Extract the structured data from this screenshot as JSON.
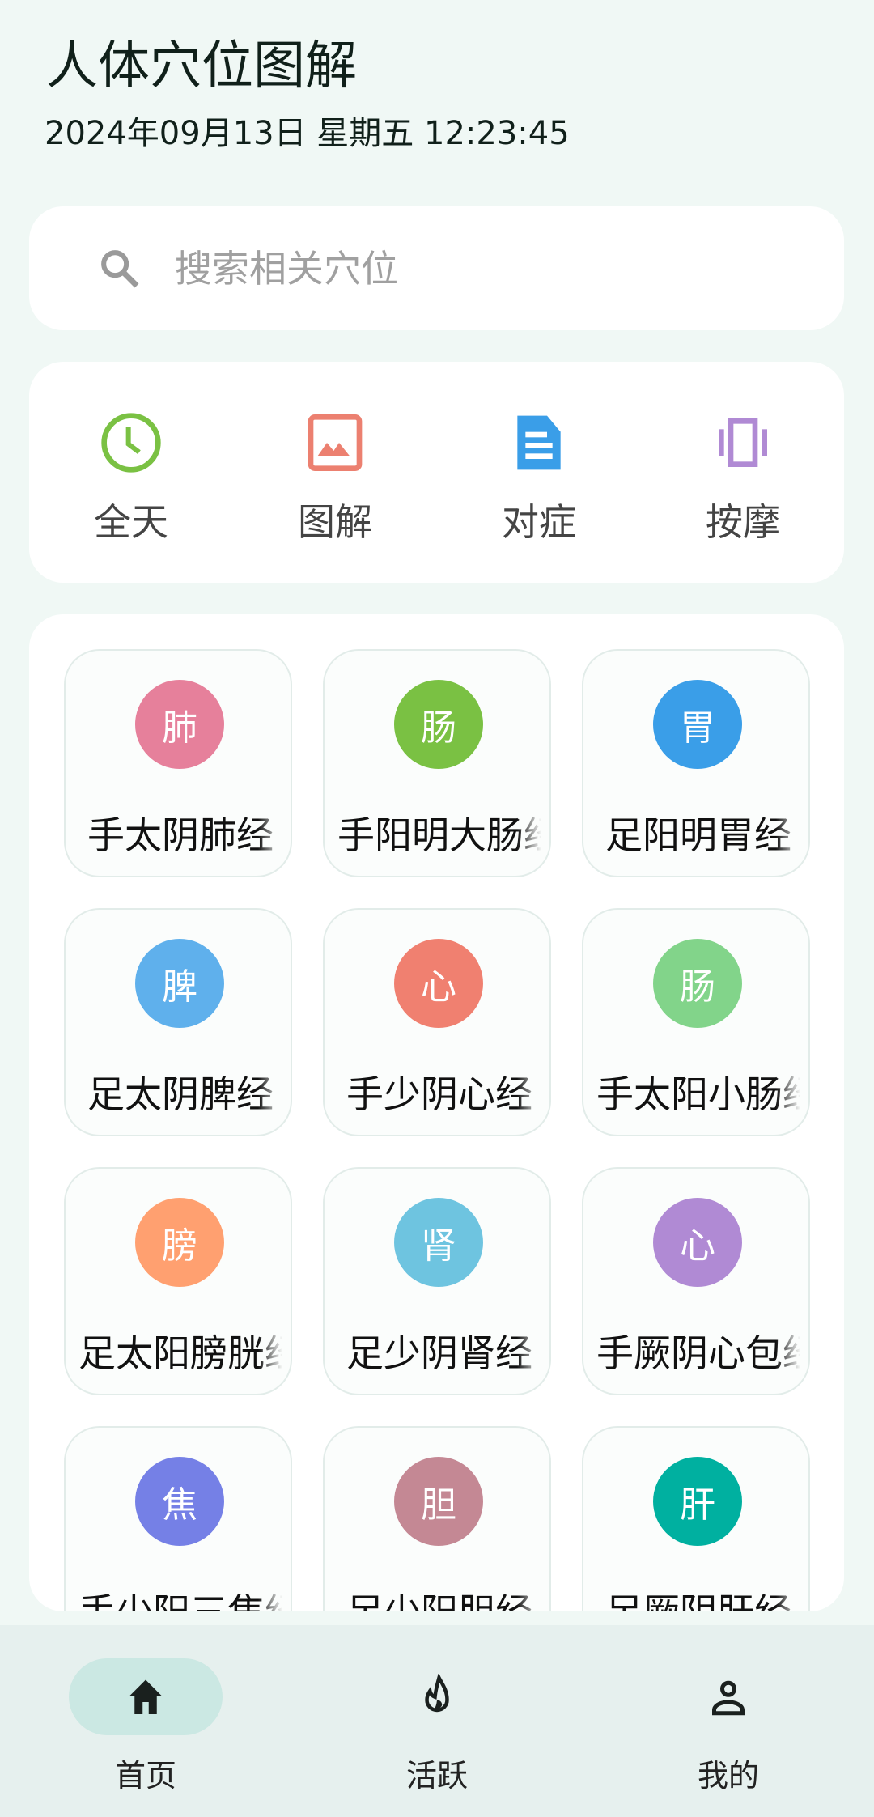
{
  "header": {
    "title": "人体穴位图解",
    "datetime": "2024年09月13日 星期五  12:23:45"
  },
  "search": {
    "placeholder": "搜索相关穴位",
    "icon": "search-icon"
  },
  "quick": [
    {
      "label": "全天",
      "icon": "clock-icon",
      "color": "#7ac143"
    },
    {
      "label": "图解",
      "icon": "image-icon",
      "color": "#ec8070"
    },
    {
      "label": "对症",
      "icon": "document-icon",
      "color": "#3a9ee8"
    },
    {
      "label": "按摩",
      "icon": "vibration-icon",
      "color": "#b08ad4"
    }
  ],
  "meridians": [
    {
      "char": "肺",
      "label": "手太阴肺经",
      "color": "#e6809b"
    },
    {
      "char": "肠",
      "label": "手阳明大肠经",
      "color": "#7ac143"
    },
    {
      "char": "胃",
      "label": "足阳明胃经",
      "color": "#3a9ee8"
    },
    {
      "char": "脾",
      "label": "足太阴脾经",
      "color": "#5fb0ec"
    },
    {
      "char": "心",
      "label": "手少阴心经",
      "color": "#f08070"
    },
    {
      "char": "肠",
      "label": "手太阳小肠经",
      "color": "#82d48a"
    },
    {
      "char": "膀",
      "label": "足太阳膀胱经",
      "color": "#ffa070"
    },
    {
      "char": "肾",
      "label": "足少阴肾经",
      "color": "#6ec4e0"
    },
    {
      "char": "心",
      "label": "手厥阴心包经",
      "color": "#b08ad4"
    },
    {
      "char": "焦",
      "label": "手少阳三焦经",
      "color": "#7580e6"
    },
    {
      "char": "胆",
      "label": "足少阳胆经",
      "color": "#c48894"
    },
    {
      "char": "肝",
      "label": "足厥阴肝经",
      "color": "#00b0a0"
    }
  ],
  "nav": [
    {
      "label": "首页",
      "icon": "home-icon",
      "active": true
    },
    {
      "label": "活跃",
      "icon": "flame-icon",
      "active": false
    },
    {
      "label": "我的",
      "icon": "person-icon",
      "active": false
    }
  ]
}
